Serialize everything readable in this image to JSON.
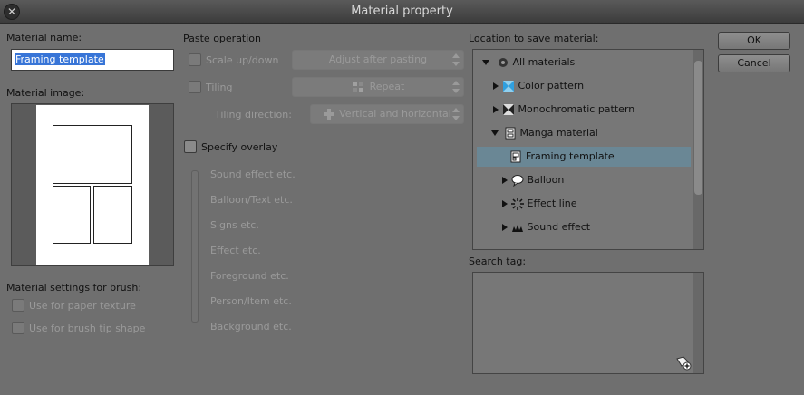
{
  "window": {
    "title": "Material property"
  },
  "left": {
    "name_label": "Material name:",
    "name_value": "Framing template",
    "image_label": "Material image:",
    "brush_label": "Material settings for brush:",
    "paper_texture": "Use for paper texture",
    "brush_tip": "Use for brush tip shape"
  },
  "paste": {
    "heading": "Paste operation",
    "scale_label": "Scale up/down",
    "scale_value": "Adjust after pasting",
    "tiling_label": "Tiling",
    "tiling_value": "Repeat",
    "direction_label": "Tiling direction:",
    "direction_value": "Vertical and horizontal",
    "overlay_label": "Specify overlay",
    "overlay_items": [
      "Sound effect etc.",
      "Balloon/Text etc.",
      "Signs etc.",
      "Effect etc.",
      "Foreground etc.",
      "Person/Item etc.",
      "Background etc."
    ]
  },
  "location": {
    "label": "Location to save material:",
    "tree": [
      {
        "label": "All materials",
        "icon": "all-materials-icon"
      },
      {
        "label": "Color pattern",
        "icon": "color-pattern-icon"
      },
      {
        "label": "Monochromatic pattern",
        "icon": "monochromatic-pattern-icon"
      },
      {
        "label": "Manga material",
        "icon": "manga-material-icon"
      },
      {
        "label": "Framing template",
        "icon": "framing-template-icon"
      },
      {
        "label": "Balloon",
        "icon": "balloon-icon"
      },
      {
        "label": "Effect line",
        "icon": "effect-line-icon"
      },
      {
        "label": "Sound effect",
        "icon": "sound-effect-icon"
      }
    ]
  },
  "search": {
    "label": "Search tag:"
  },
  "buttons": {
    "ok": "OK",
    "cancel": "Cancel"
  },
  "colors": {
    "selection": "#3875d7",
    "tree_selected": "#6a8795",
    "background": "#6f6f6f"
  }
}
